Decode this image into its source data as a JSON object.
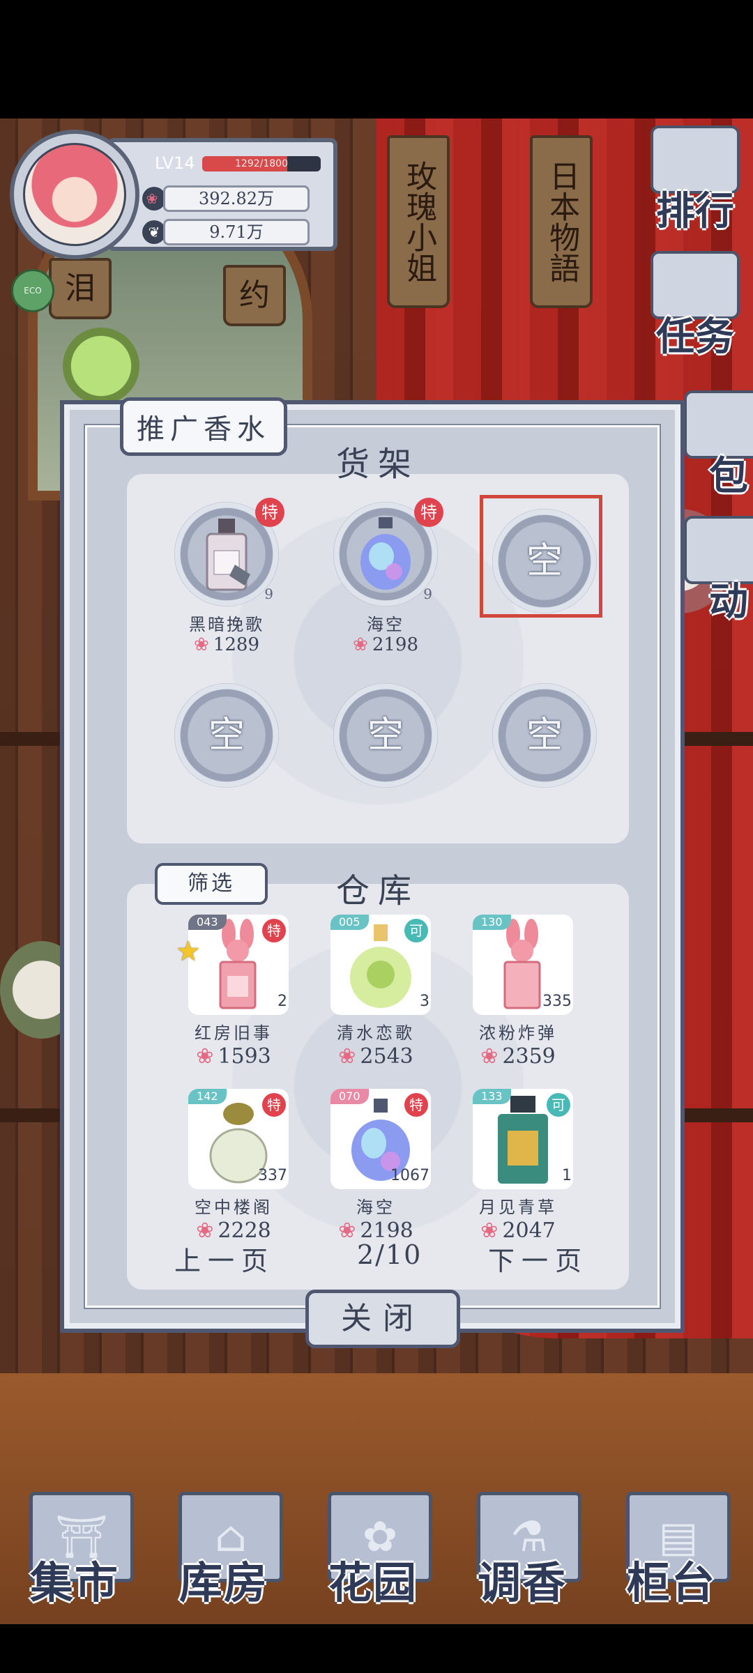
{
  "player": {
    "level_label": "LV14",
    "exp_text": "1292/1800",
    "exp_fraction": 0.72,
    "money": "392.82万",
    "petals": "9.71万"
  },
  "badge": {
    "label": "ECO"
  },
  "scene_tags": {
    "tag1": "玫瑰小姐",
    "tag2": "日本物語",
    "tag3": "泪",
    "tag4": "约"
  },
  "side_menu": [
    {
      "label": "排行",
      "icon": "ranking-icon"
    },
    {
      "label": "任务",
      "icon": "task-icon"
    },
    {
      "label": "包",
      "icon": "bag-icon"
    },
    {
      "label": "动",
      "icon": "event-icon"
    }
  ],
  "dialog": {
    "title": "推广香水",
    "shelf_heading": "货架",
    "warehouse_heading": "仓库",
    "filter_label": "筛选",
    "prev_label": "上一页",
    "page_indicator": "2/10",
    "next_label": "下一页",
    "close_label": "关闭"
  },
  "shelf": [
    {
      "name": "黑暗挽歌",
      "price": "1289",
      "badge": "特",
      "count": "9",
      "empty": false
    },
    {
      "name": "海空",
      "price": "2198",
      "badge": "特",
      "count": "9",
      "empty": false
    },
    {
      "empty_label": "空",
      "empty": true,
      "selected": true
    },
    {
      "empty_label": "空",
      "empty": true
    },
    {
      "empty_label": "空",
      "empty": true
    },
    {
      "empty_label": "空",
      "empty": true
    }
  ],
  "warehouse": [
    {
      "code": "043",
      "badge": "特",
      "qty": "2",
      "name": "红房旧事",
      "price": "1593",
      "starred": true,
      "code_color": "#6f7586",
      "badge_color": "#e0424e"
    },
    {
      "code": "005",
      "badge": "可",
      "qty": "3",
      "name": "清水恋歌",
      "price": "2543",
      "code_color": "#69c3c4",
      "badge_color": "#49b9b6"
    },
    {
      "code": "130",
      "badge": "",
      "qty": "335",
      "name": "浓粉炸弹",
      "price": "2359",
      "code_color": "#69c3c4",
      "badge_color": "#49b9b6"
    },
    {
      "code": "142",
      "badge": "特",
      "qty": "337",
      "name": "空中楼阁",
      "price": "2228",
      "code_color": "#69c3c4",
      "badge_color": "#e0424e"
    },
    {
      "code": "070",
      "badge": "特",
      "qty": "1067",
      "name": "海空",
      "price": "2198",
      "code_color": "#e88aa5",
      "badge_color": "#e0424e"
    },
    {
      "code": "133",
      "badge": "可",
      "qty": "1",
      "name": "月见青草",
      "price": "2047",
      "code_color": "#69c3c4",
      "badge_color": "#49b9b6"
    }
  ],
  "bottom_nav": [
    {
      "label": "集市",
      "icon": "market-icon"
    },
    {
      "label": "库房",
      "icon": "storehouse-icon"
    },
    {
      "label": "花园",
      "icon": "garden-icon"
    },
    {
      "label": "调香",
      "icon": "blending-icon"
    },
    {
      "label": "柜台",
      "icon": "counter-icon"
    }
  ]
}
